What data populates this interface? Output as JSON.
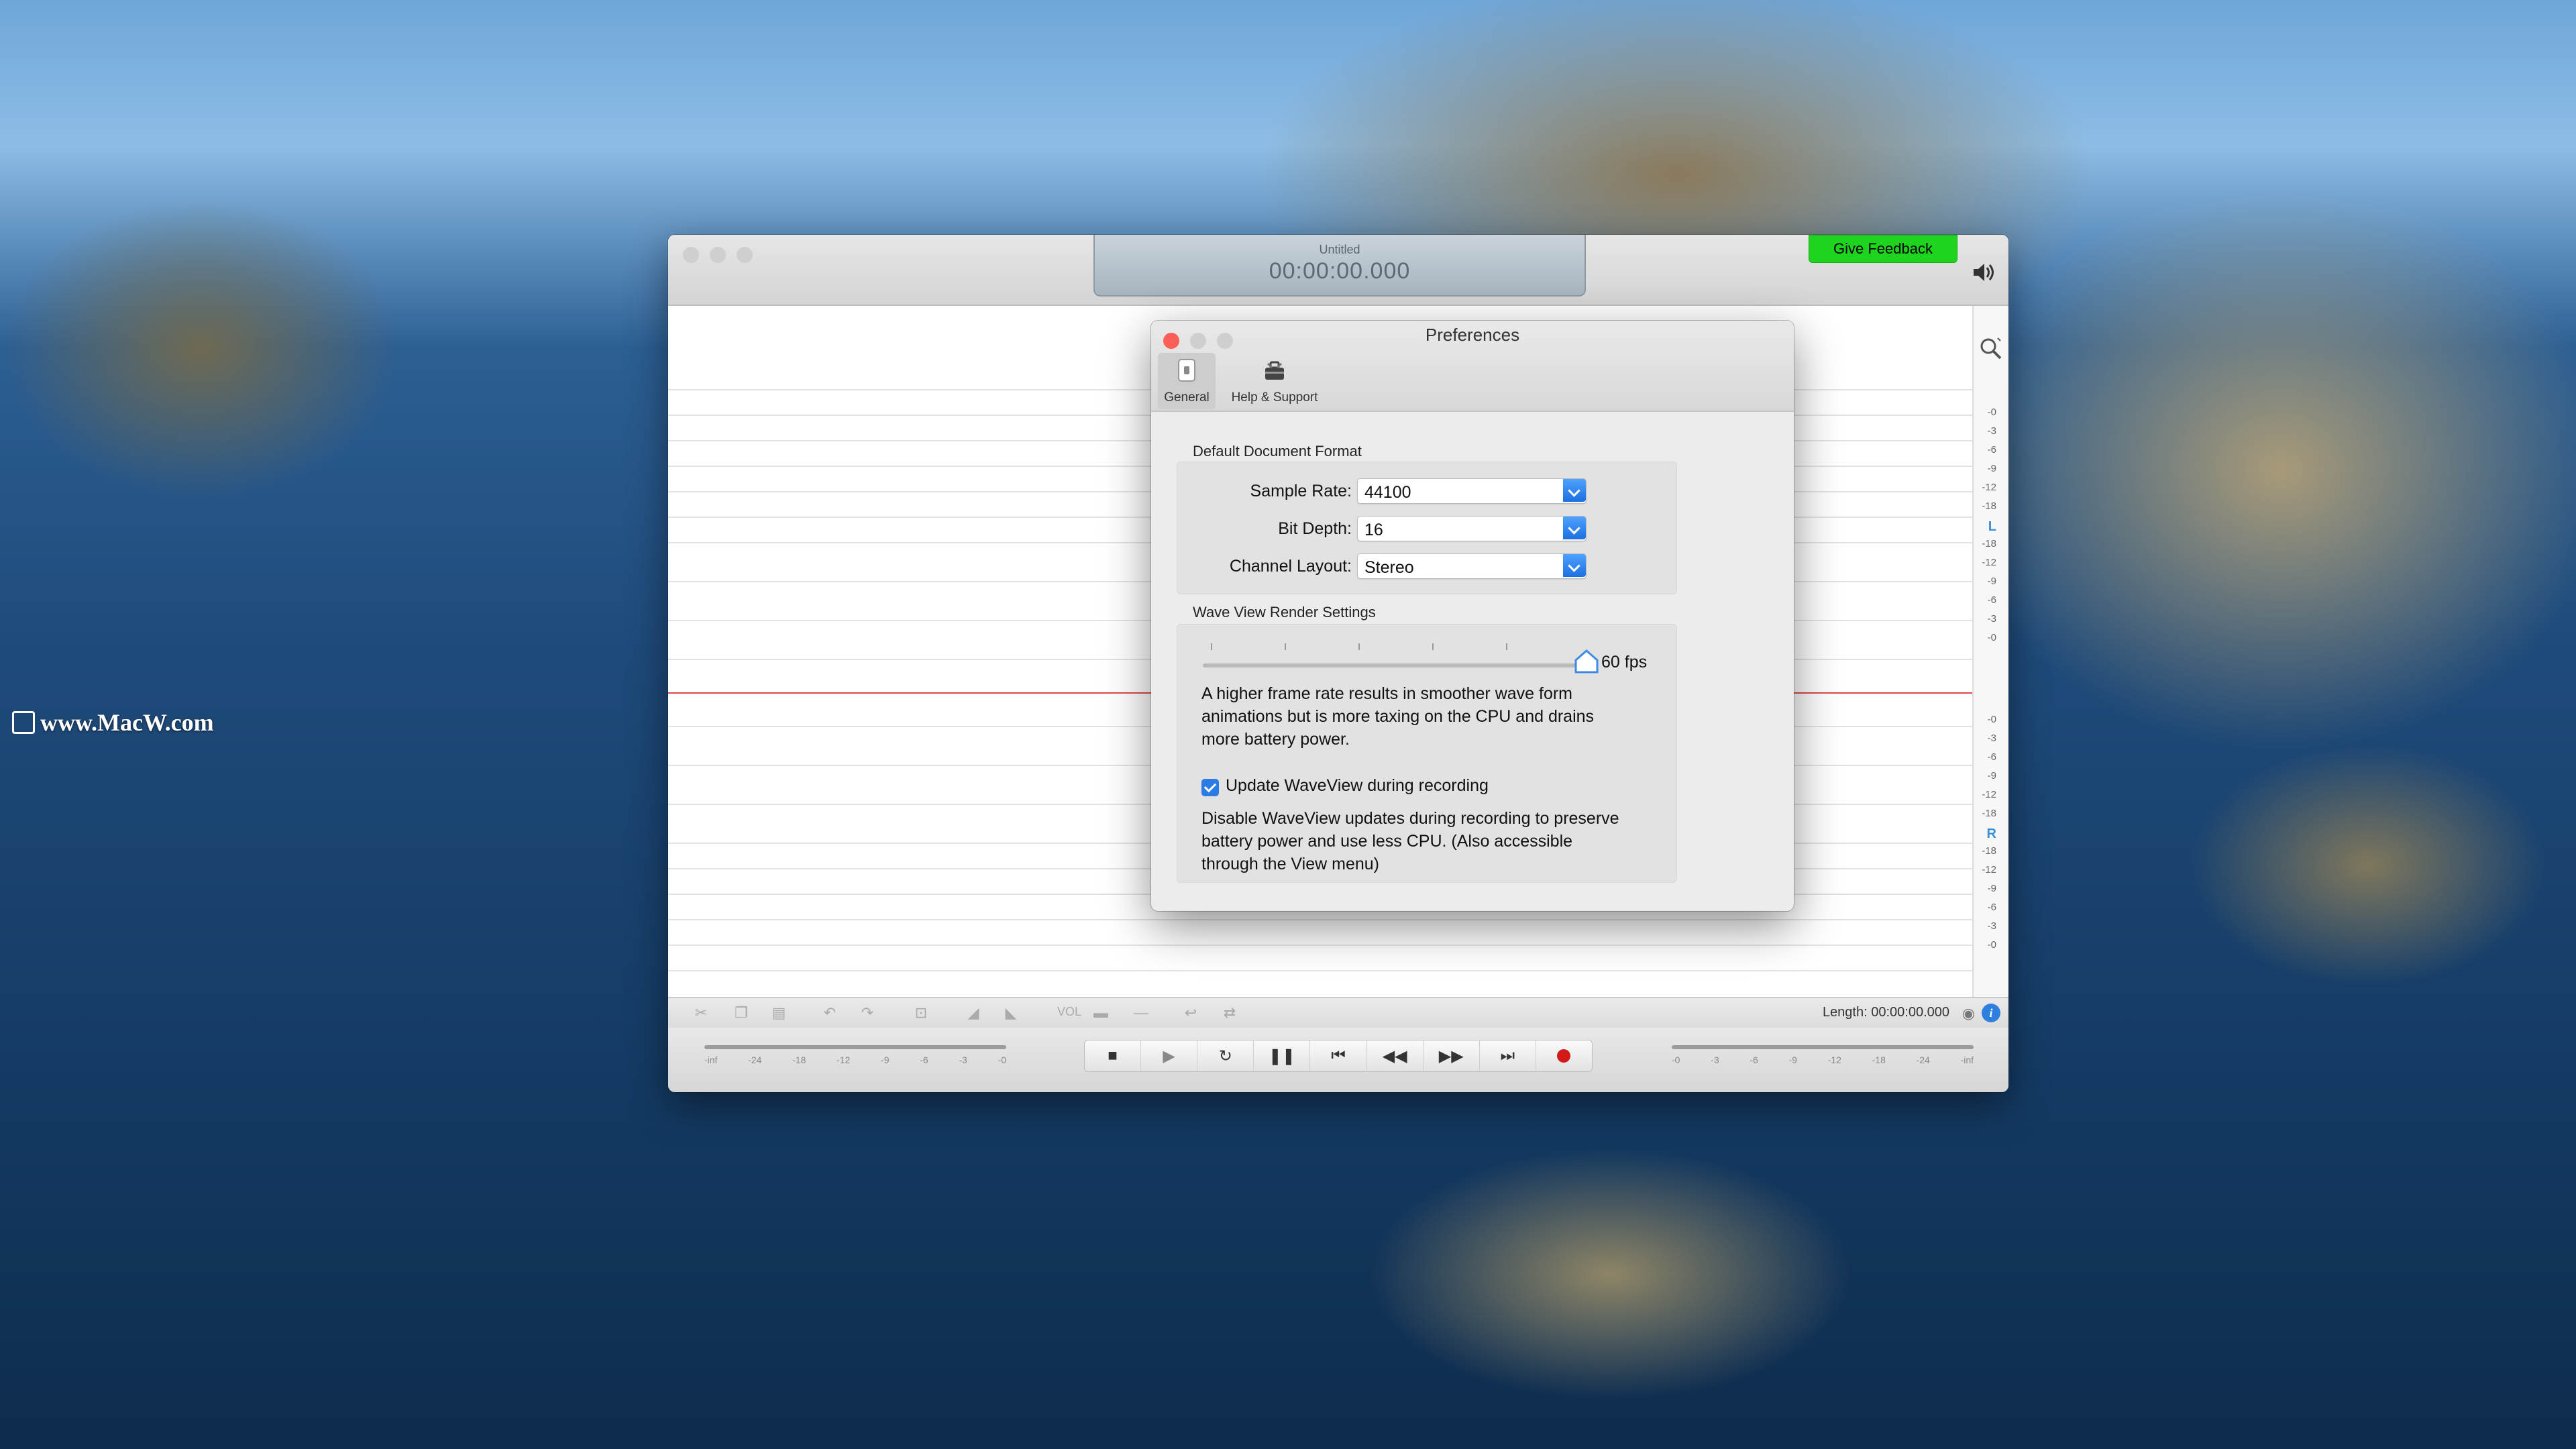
{
  "desktop": {
    "watermark": "www.MacW.com"
  },
  "app": {
    "document_title": "Untitled",
    "timecode": "00:00:00.000",
    "feedback_label": "Give Feedback",
    "ruler": {
      "top": [
        "-0",
        "-3",
        "-6",
        "-9",
        "-12",
        "-18",
        "L",
        "-18",
        "-12",
        "-9",
        "-6",
        "-3",
        "-0"
      ],
      "bottom": [
        "-0",
        "-3",
        "-6",
        "-9",
        "-12",
        "-18",
        "R",
        "-18",
        "-12",
        "-9",
        "-6",
        "-3",
        "-0"
      ]
    },
    "toolbar": {
      "vol_label": "VOL",
      "length_label": "Length: 00:00:00.000",
      "info_label": "i"
    },
    "input_meter_labels": [
      "-inf",
      "-24",
      "-18",
      "-12",
      "-9",
      "-6",
      "-3",
      "-0"
    ],
    "output_meter_labels": [
      "-0",
      "-3",
      "-6",
      "-9",
      "-12",
      "-18",
      "-24",
      "-inf"
    ],
    "transport": [
      "stop",
      "play",
      "loop",
      "pause",
      "skip-back",
      "rewind",
      "fast-forward",
      "skip-forward",
      "record"
    ]
  },
  "prefs": {
    "title": "Preferences",
    "tabs": [
      {
        "label": "General",
        "icon": "switch-icon",
        "active": true
      },
      {
        "label": "Help & Support",
        "icon": "toolbox-icon",
        "active": false
      }
    ],
    "default_format": {
      "heading": "Default Document Format",
      "sample_rate_label": "Sample Rate:",
      "sample_rate_value": "44100",
      "bit_depth_label": "Bit Depth:",
      "bit_depth_value": "16",
      "channel_layout_label": "Channel Layout:",
      "channel_layout_value": "Stereo"
    },
    "wave_view": {
      "heading": "Wave View Render Settings",
      "fps_label": "60 fps",
      "fps_slider_fraction": 1.0,
      "frame_rate_help": "A higher frame rate results in smoother wave form animations but is more taxing on the CPU and drains more battery power.",
      "update_checkbox_label": "Update WaveView during recording",
      "update_checkbox_checked": true,
      "update_help": "Disable WaveView updates during recording to preserve battery power and use less CPU. (Also accessible through the View menu)"
    }
  },
  "colors": {
    "record": "#d21a1a",
    "accent": "#2a7be4",
    "feedback": "#1fd41f",
    "close": "#fc5f57"
  }
}
